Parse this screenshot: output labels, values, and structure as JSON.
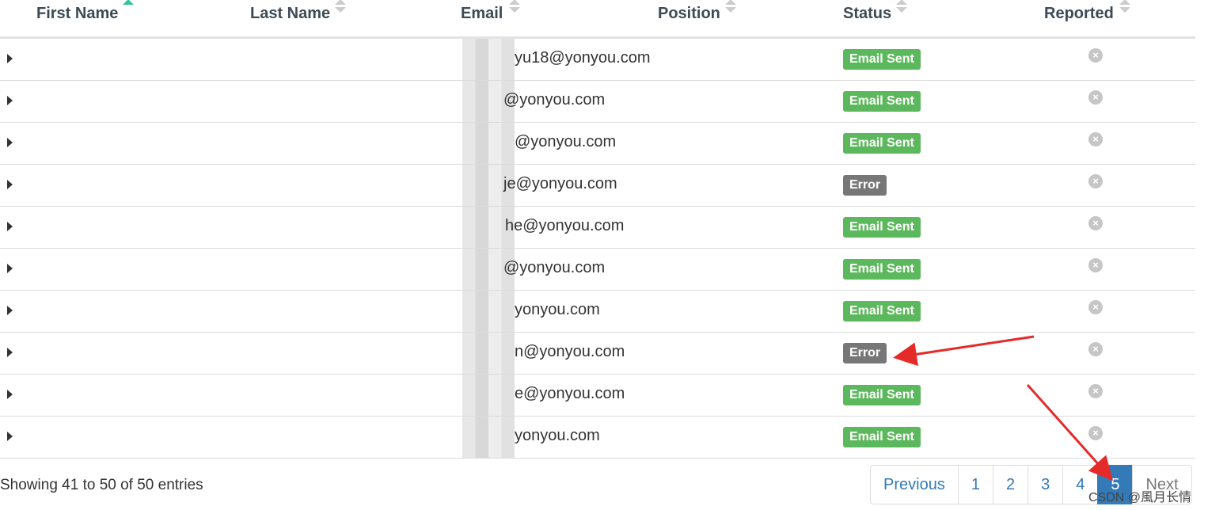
{
  "columns": [
    "First Name",
    "Last Name",
    "Email",
    "Position",
    "Status",
    "Reported"
  ],
  "rows": [
    {
      "email": "yu18@yonyou.com",
      "status": "Email Sent"
    },
    {
      "email": "@yonyou.com",
      "status": "Email Sent"
    },
    {
      "email": "@yonyou.com",
      "status": "Email Sent"
    },
    {
      "email": "je@yonyou.com",
      "status": "Error"
    },
    {
      "email": "he@yonyou.com",
      "status": "Email Sent"
    },
    {
      "email": "@yonyou.com",
      "status": "Email Sent"
    },
    {
      "email": "yonyou.com",
      "status": "Email Sent"
    },
    {
      "email": "n@yonyou.com",
      "status": "Error"
    },
    {
      "email": "e@yonyou.com",
      "status": "Email Sent"
    },
    {
      "email": "yonyou.com",
      "status": "Email Sent"
    }
  ],
  "footer": {
    "info": "Showing 41 to 50 of 50 entries",
    "pagination": {
      "previous": "Previous",
      "pages": [
        "1",
        "2",
        "3",
        "4",
        "5"
      ],
      "active": "5",
      "next": "Next"
    }
  },
  "watermark": "CSDN @風月长情",
  "colors": {
    "sent": "#5cb85c",
    "error": "#777777",
    "active_page": "#337ab7",
    "annotation_arrow": "#e52a2a"
  },
  "icons": {
    "reported": "close-circle-icon",
    "expand": "caret-right-icon"
  }
}
